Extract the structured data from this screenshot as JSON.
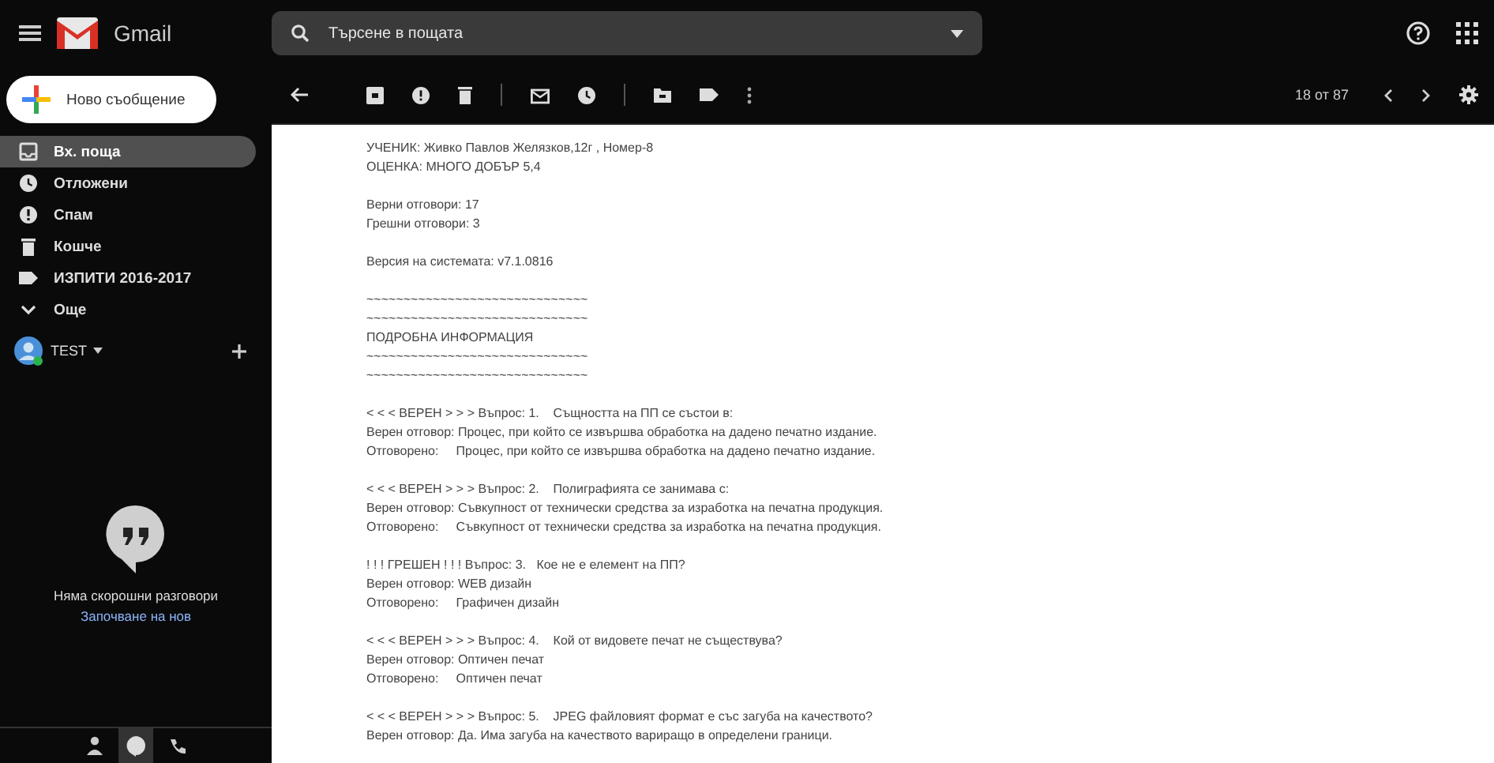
{
  "app": {
    "name": "Gmail"
  },
  "search": {
    "placeholder": "Търсене в пощата"
  },
  "compose": {
    "label": "Ново съобщение"
  },
  "sidebar": {
    "items": [
      {
        "kind": "inbox",
        "label": "Вх. поща",
        "selected": true
      },
      {
        "kind": "snoozed",
        "label": "Отложени",
        "selected": false
      },
      {
        "kind": "spam",
        "label": "Спам",
        "selected": false
      },
      {
        "kind": "trash",
        "label": "Кошче",
        "selected": false
      },
      {
        "kind": "label",
        "label": "ИЗПИТИ 2016-2017",
        "selected": false
      },
      {
        "kind": "more",
        "label": "Още",
        "selected": false
      }
    ]
  },
  "account": {
    "name": "TEST"
  },
  "hangouts": {
    "empty_text": "Няма скорошни разговори",
    "start_link": "Започване на нов"
  },
  "pager": {
    "text": "18 от 87"
  },
  "email": {
    "paragraphs": [
      [
        "УЧЕНИК: Живко Павлов Желязков,12г , Номер-8",
        "ОЦЕНКА: МНОГО ДОБЪР 5,4"
      ],
      [
        "Верни отговори: 17",
        "Грешни отговори: 3"
      ],
      [
        "Версия на системата: v7.1.0816"
      ],
      [
        "~~~~~~~~~~~~~~~~~~~~~~~~~~~~~~",
        "~~~~~~~~~~~~~~~~~~~~~~~~~~~~~~",
        "ПОДРОБНА ИНФОРМАЦИЯ",
        "~~~~~~~~~~~~~~~~~~~~~~~~~~~~~~",
        "~~~~~~~~~~~~~~~~~~~~~~~~~~~~~~"
      ],
      [
        "< < < ВЕРЕН > > > Въпрос: 1.    Същността на ПП се състои в:",
        "Верен отговор: Процес, при който се извършва обработка на дадено печатно издание.",
        "Отговорено:     Процес, при който се извършва обработка на дадено печатно издание."
      ],
      [
        "< < < ВЕРЕН > > > Въпрос: 2.    Полиграфията се занимава с:",
        "Верен отговор: Съвкупност от технически средства за изработка на печатна продукция.",
        "Отговорено:     Съвкупност от технически средства за изработка на печатна продукция."
      ],
      [
        "! ! ! ГРЕШЕН ! ! ! Въпрос: 3.   Кое не е елемент на ПП?",
        "Верен отговор: WEB дизайн",
        "Отговорено:     Графичен дизайн"
      ],
      [
        "< < < ВЕРЕН > > > Въпрос: 4.    Кой от видовете печат не съществува?",
        "Верен отговор: Оптичен печат",
        "Отговорено:     Оптичен печат"
      ],
      [
        "< < < ВЕРЕН > > > Въпрос: 5.    JPEG файловият формат е със загуба на качеството?",
        "Верен отговор: Да. Има загуба на качеството вариращо в определени граници."
      ]
    ]
  }
}
